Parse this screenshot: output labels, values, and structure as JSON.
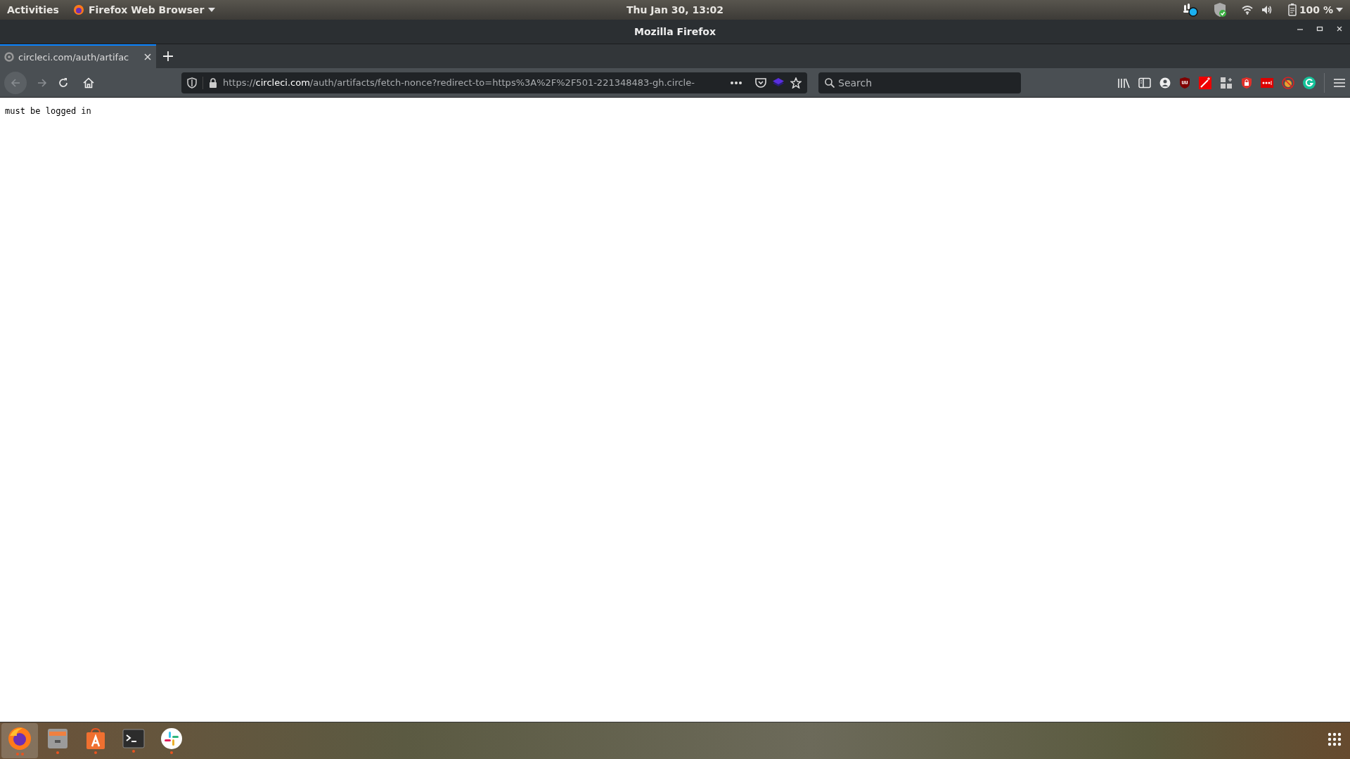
{
  "top_bar": {
    "activities": "Activities",
    "app_menu": "Firefox Web Browser",
    "clock": "Thu Jan 30, 13:02",
    "battery": "100 %"
  },
  "window": {
    "title": "Mozilla Firefox"
  },
  "tabs": [
    {
      "label": "circleci.com/auth/artifac",
      "selected": true
    }
  ],
  "nav": {
    "back_disabled": true,
    "forward_disabled": true
  },
  "url": {
    "scheme": "https://",
    "domain": "circleci.com",
    "rest": "/auth/artifacts/fetch-nonce?redirect-to=https%3A%2F%2F501-221348483-gh.circle-"
  },
  "search": {
    "placeholder": "Search"
  },
  "page": {
    "text": "must be logged in"
  },
  "dock": [
    {
      "kind": "browser",
      "selected": true,
      "running": true,
      "multi": true
    },
    {
      "kind": "files",
      "selected": false,
      "running": true,
      "multi": false
    },
    {
      "kind": "store",
      "selected": false,
      "running": true,
      "multi": false
    },
    {
      "kind": "terminal",
      "selected": false,
      "running": true,
      "multi": false
    },
    {
      "kind": "chat",
      "selected": false,
      "running": true,
      "multi": false
    }
  ]
}
